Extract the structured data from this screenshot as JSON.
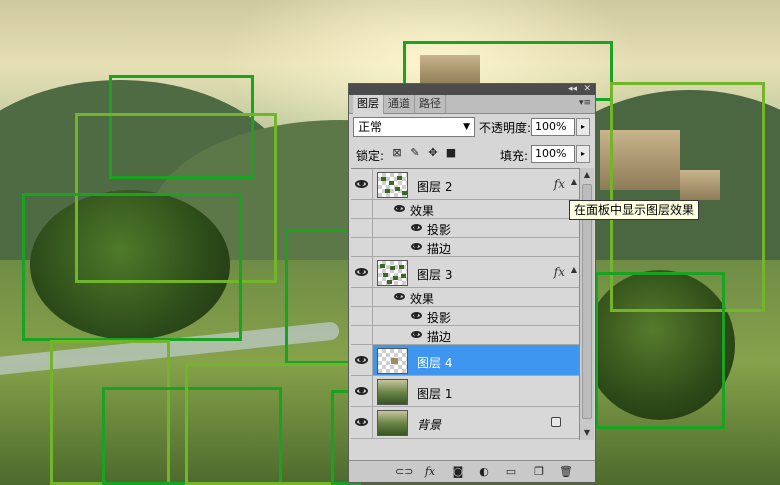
{
  "panel": {
    "tabs": [
      {
        "label": "图层",
        "active": true
      },
      {
        "label": "通道",
        "active": false
      },
      {
        "label": "路径",
        "active": false
      }
    ],
    "blend_mode": "正常",
    "opacity_label": "不透明度:",
    "opacity_value": "100%",
    "lock_label": "锁定:",
    "fill_label": "填充:",
    "fill_value": "100%",
    "layers": [
      {
        "name": "图层 2",
        "fx": "fx",
        "effects_label": "效果",
        "effects": [
          "投影",
          "描边"
        ]
      },
      {
        "name": "图层 3",
        "fx": "fx",
        "effects_label": "效果",
        "effects": [
          "投影",
          "描边"
        ]
      },
      {
        "name": "图层 4",
        "selected": true
      },
      {
        "name": "图层 1"
      },
      {
        "name": "背景",
        "locked": true
      }
    ]
  },
  "tooltip": "在面板中显示图层效果",
  "colors": {
    "selection": "#3e96ef",
    "frame": "#1aa322",
    "panel": "#d6d6d6"
  },
  "icons": [
    "visibility-eye-icon",
    "link-icon",
    "fx-icon",
    "mask-icon",
    "adjustment-icon",
    "group-folder-icon",
    "new-layer-icon",
    "trash-icon",
    "lock-icon"
  ]
}
